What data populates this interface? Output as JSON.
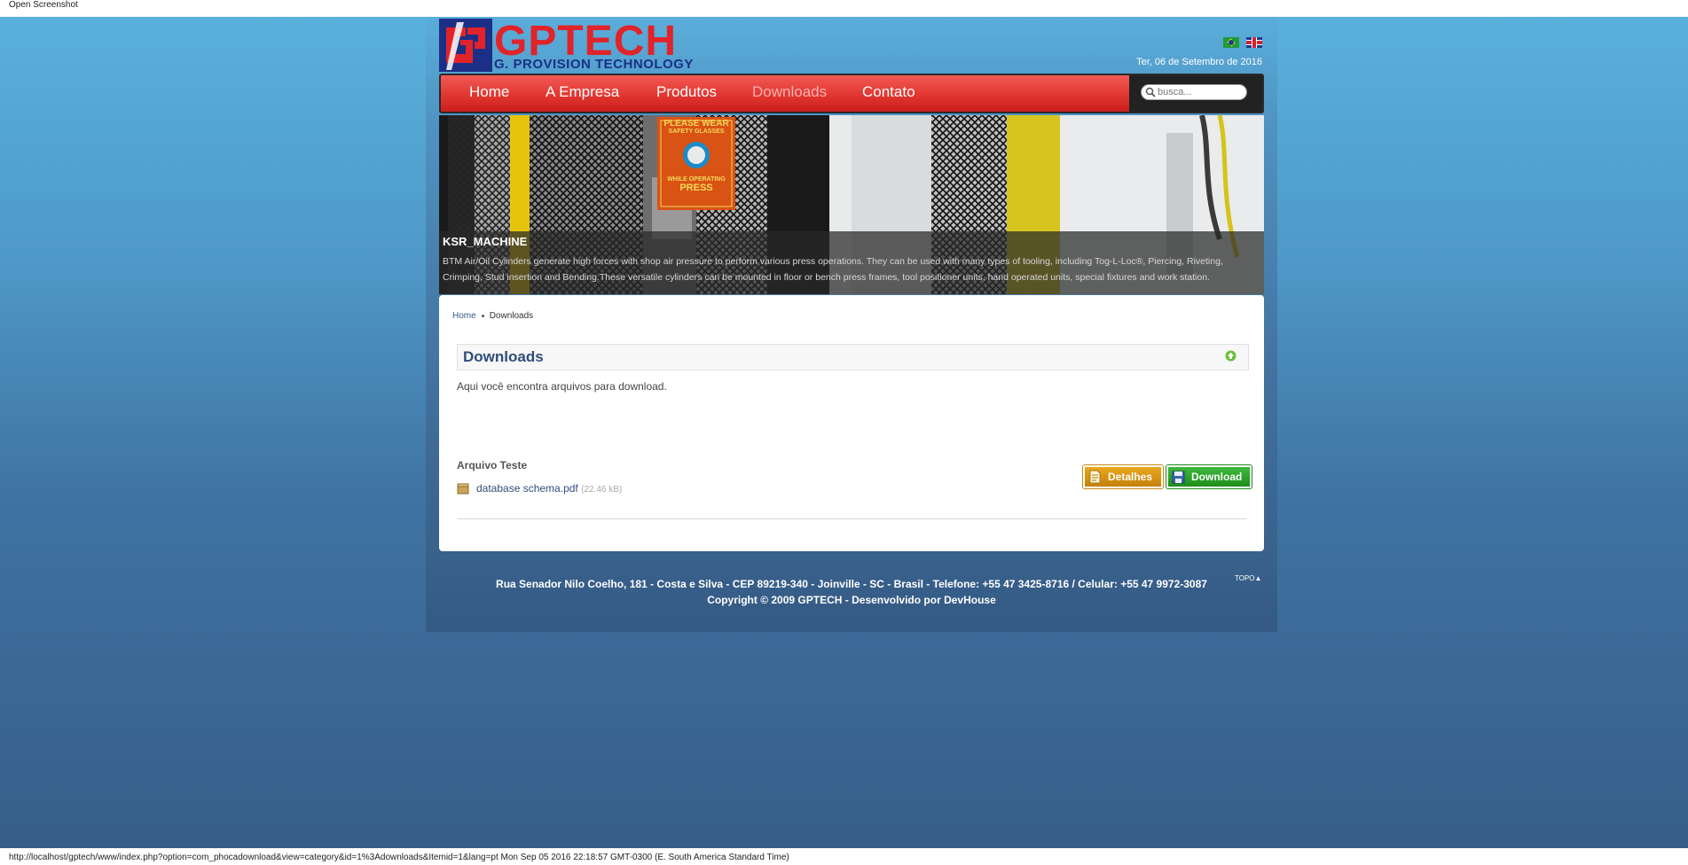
{
  "window": {
    "title": "Open Screenshot"
  },
  "header": {
    "logo_word": "GPTECH",
    "logo_sub": "G. PROVISION TECHNOLOGY",
    "date": "Ter, 06 de Setembro de 2016",
    "flags": [
      "brazil-flag-icon",
      "uk-flag-icon"
    ]
  },
  "nav": {
    "items": [
      {
        "label": "Home"
      },
      {
        "label": "A Empresa"
      },
      {
        "label": "Produtos"
      },
      {
        "label": "Downloads",
        "active": true
      },
      {
        "label": "Contato"
      }
    ],
    "search_placeholder": "busca..."
  },
  "banner": {
    "title": "KSR_MACHINE",
    "text": "BTM Air/Oil Cylinders generate high forces with shop air pressure to perform various press operations. They can be used with many types of tooling, including Tog-L-Loc®, Piercing, Riveting, Crimping, Stud insertion and Bending.These versatile cylinders can be mounted in floor or bench press frames, tool positioner units, hand operated units, special fixtures and work station.",
    "sign_line1": "PLEASE WEAR",
    "sign_line2": "SAFETY GLASSES",
    "sign_line3": "WHILE OPERATING",
    "sign_line4": "PRESS"
  },
  "breadcrumb": {
    "home": "Home",
    "current": "Downloads"
  },
  "downloads": {
    "title": "Downloads",
    "description": "Aqui você encontra arquivos para download.",
    "file_title": "Arquivo Teste",
    "file_name": "database schema.pdf",
    "file_size": "(22.46 kB)",
    "details_label": "Detalhes",
    "download_label": "Download"
  },
  "footer": {
    "line1": "Rua Senador Nilo Coelho, 181 - Costa e Silva - CEP 89219-340 - Joinville - SC - Brasil - Telefone: +55 47 3425-8716 / Celular: +55 47 9972-3087",
    "line2": "Copyright © 2009 GPTECH - Desenvolvido por DevHouse",
    "topo": "TOPO"
  },
  "statusbar": {
    "text": "http://localhost/gptech/www/index.php?option=com_phocadownload&view=category&id=1%3Adownloads&Itemid=1&lang=pt Mon Sep 05 2016 22:18:57 GMT-0300 (E. South America Standard Time)"
  },
  "colors": {
    "nav_red": "#e23630",
    "brand_red": "#e1232a",
    "brand_blue": "#1c2f86",
    "details_orange": "#d99414",
    "download_green": "#2aa327"
  }
}
